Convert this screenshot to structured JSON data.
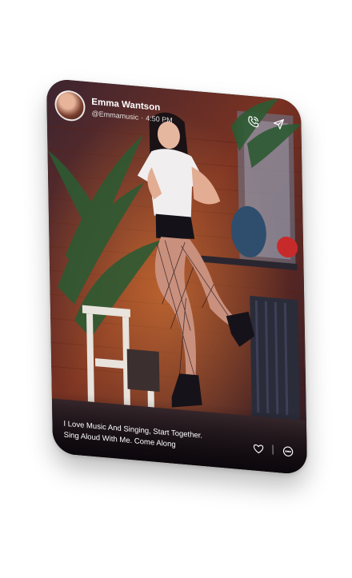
{
  "post": {
    "user_name": "Emma Wantson",
    "handle": "@Emmamusic",
    "time": "4:50 PM",
    "caption": "I Love Music And Singing, Start Together. Sing Aloud With Me. Come Along"
  },
  "icons": {
    "call": "phone-icon",
    "share": "send-icon",
    "like": "heart-icon",
    "comment": "comment-icon"
  },
  "colors": {
    "text": "#ffffff",
    "wall": "#8a3b2a",
    "dark_overlay": "#08050a"
  }
}
